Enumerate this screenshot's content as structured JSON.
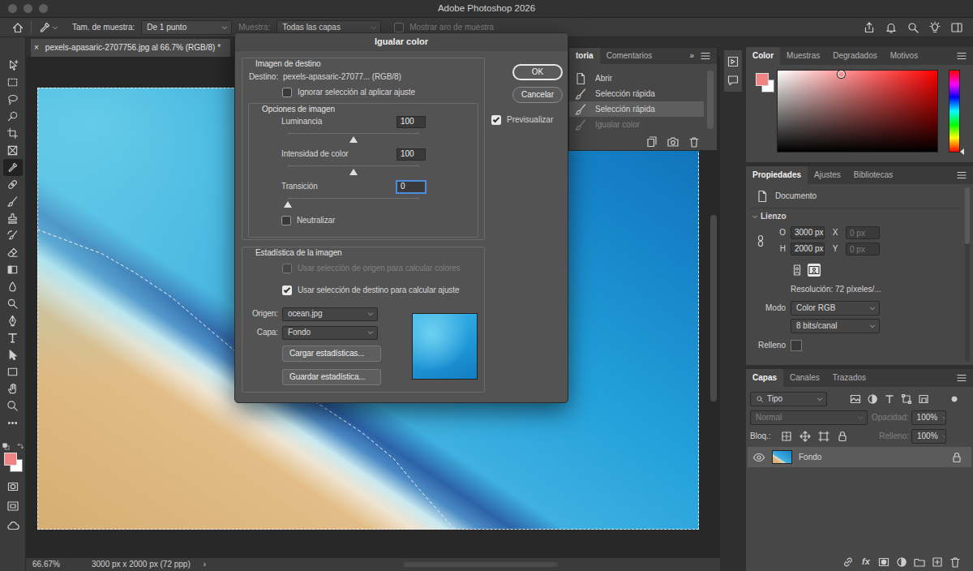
{
  "window": {
    "title": "Adobe Photoshop 2026"
  },
  "options_bar": {
    "sample_size": {
      "label": "Tam. de muestra:",
      "value": "De 1 punto"
    },
    "sample": {
      "label": "Muestra:",
      "value": "Todas las capas",
      "disabled": true
    },
    "show_ring": {
      "label": "Mostrar aro de muestra",
      "checked": false,
      "disabled": true
    }
  },
  "document_tab": {
    "close": "×",
    "title": "pexels-apasaric-2707756.jpg al 66.7% (RGB/8) *",
    "selected": true
  },
  "tools": [
    {
      "selected": false
    },
    {
      "selected": false
    },
    {
      "selected": false
    },
    {
      "selected": false
    },
    {
      "selected": false
    },
    {
      "selected": false
    },
    {
      "selected": true
    },
    {
      "selected": false
    },
    {
      "selected": false
    },
    {
      "selected": false
    },
    {
      "selected": false
    },
    {
      "selected": false
    },
    {
      "selected": false
    },
    {
      "selected": false
    },
    {
      "selected": false
    },
    {
      "selected": false
    },
    {
      "selected": false
    },
    {
      "selected": false
    },
    {
      "selected": false
    },
    {
      "selected": false
    },
    {
      "selected": false
    },
    {
      "selected": false
    }
  ],
  "swatches": {
    "foreground": "#f08484",
    "background": "#ffffff"
  },
  "canvas": {
    "selection": true
  },
  "status_bar": {
    "zoom": "66.67%",
    "size": "3000 px x 2000 px (72 ppp)",
    "arrow": "›"
  },
  "history_panel": {
    "tabs": [
      {
        "label": "toria",
        "selected": true
      },
      {
        "label": "Comentarios",
        "selected": false
      }
    ],
    "more": "»",
    "items": [
      {
        "label": "Abrir",
        "kind": "open",
        "selected": false,
        "disabled": false
      },
      {
        "label": "Selección rápida",
        "kind": "brush",
        "selected": false,
        "disabled": false
      },
      {
        "label": "Selección rápida",
        "kind": "brush",
        "selected": true,
        "disabled": false
      },
      {
        "label": "Igualar color",
        "kind": "brush",
        "selected": false,
        "disabled": true
      }
    ]
  },
  "color_panel": {
    "tabs": [
      {
        "label": "Color",
        "selected": true
      },
      {
        "label": "Muestras",
        "selected": false
      },
      {
        "label": "Degradados",
        "selected": false
      },
      {
        "label": "Motivos",
        "selected": false
      }
    ],
    "hue": 0,
    "saturation": 0.4,
    "brightness": 0.96
  },
  "properties_panel": {
    "tabs": [
      {
        "label": "Propiedades",
        "selected": true
      },
      {
        "label": "Ajustes",
        "selected": false
      },
      {
        "label": "Bibliotecas",
        "selected": false
      }
    ],
    "type": "Documento",
    "section": {
      "label": "Lienzo",
      "expanded": true
    },
    "width": {
      "label": "O",
      "value": "3000 px"
    },
    "height": {
      "label": "H",
      "value": "2000 px"
    },
    "x": {
      "label": "X",
      "placeholder": "0 px"
    },
    "y": {
      "label": "Y",
      "placeholder": "0 px"
    },
    "orientation": [
      {
        "kind": "portrait",
        "selected": false
      },
      {
        "kind": "landscape",
        "selected": true
      }
    ],
    "resolution": "Resolución: 72 píxeles/...",
    "mode": {
      "label": "Modo",
      "value": "Color RGB"
    },
    "depth": {
      "value": "8 bits/canal"
    },
    "fill": {
      "label": "Relleno"
    }
  },
  "layers_panel": {
    "tabs": [
      {
        "label": "Capas",
        "selected": true
      },
      {
        "label": "Canales",
        "selected": false
      },
      {
        "label": "Trazados",
        "selected": false
      }
    ],
    "filter": {
      "value": "Tipo"
    },
    "blend": {
      "value": "Normal",
      "disabled": true
    },
    "opacity": {
      "label": "Opacidad:",
      "value": "100%",
      "disabled": true
    },
    "lock": {
      "label": "Bloq.:"
    },
    "fill": {
      "label": "Relleno:",
      "value": "100%",
      "disabled": true
    },
    "layers": [
      {
        "name": "Fondo",
        "visible": true,
        "locked": true,
        "selected": true
      }
    ],
    "footer_fx": "fx"
  },
  "dialog": {
    "title": "Igualar color",
    "target": {
      "legend": "Imagen de destino",
      "label": "Destino:",
      "value": "pexels-apasaric-27077... (RGB/8)",
      "ignore": {
        "label": "Ignorar selección al aplicar ajuste",
        "checked": false
      }
    },
    "options": {
      "legend": "Opciones de imagen",
      "sliders": [
        {
          "label": "Luminancia",
          "value": "100",
          "level": 0.5,
          "focused": false
        },
        {
          "label": "Intensidad de color",
          "value": "100",
          "level": 0.5,
          "focused": false
        },
        {
          "label": "Transición",
          "value": "0",
          "level": 0,
          "focused": true
        }
      ],
      "neutralize": {
        "label": "Neutralizar",
        "checked": false
      }
    },
    "stats": {
      "legend": "Estadística de la imagen",
      "checks": [
        {
          "label": "Usar selección de origen para calcular colores",
          "checked": false,
          "disabled": true
        },
        {
          "label": "Usar selección de destino para calcular ajuste",
          "checked": true,
          "disabled": false
        }
      ],
      "source": {
        "label": "Origen:",
        "value": "ocean.jpg"
      },
      "layer": {
        "label": "Capa:",
        "value": "Fondo"
      },
      "buttons": [
        "Cargar estadísticas...",
        "Guardar estadística..."
      ]
    },
    "buttons": [
      {
        "label": "OK",
        "default": true
      },
      {
        "label": "Cancelar",
        "default": false
      }
    ],
    "preview": {
      "label": "Previsualizar",
      "checked": true
    }
  }
}
